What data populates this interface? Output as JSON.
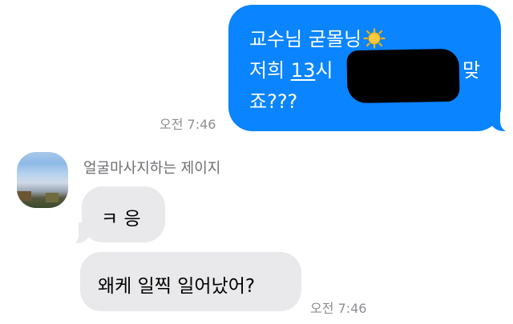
{
  "thread": {
    "outgoing": {
      "line1": "교수님 굳몰닝",
      "line2_prefix": "저희 ",
      "line2_underlined": "13",
      "line2_suffix": "시 ",
      "line2_end": "맞",
      "line3": "죠???",
      "timestamp": "오전 7:46"
    },
    "incoming": {
      "sender_name": "얼굴마사지하는 제이지",
      "message1": "ㅋ 응",
      "message2": "왜케 일찍 일어났어?",
      "timestamp": "오전 7:46"
    }
  },
  "icons": {
    "sun": "sun-emoji-icon"
  },
  "colors": {
    "outgoing_bubble": "#0a84ff",
    "incoming_bubble": "#e9e9eb",
    "timestamp_text": "#8e8e93"
  }
}
